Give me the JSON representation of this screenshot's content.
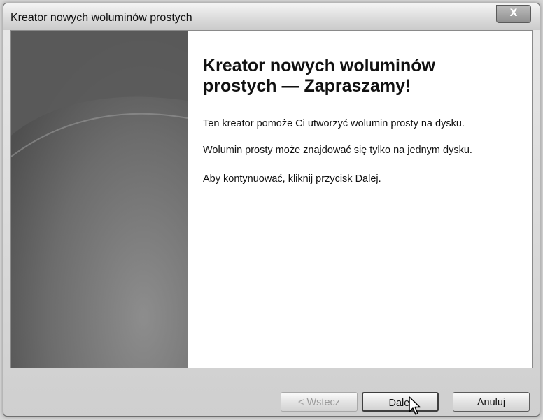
{
  "window": {
    "title": "Kreator nowych woluminów prostych",
    "close_label": "X"
  },
  "main": {
    "heading": "Kreator nowych woluminów prostych — Zapraszamy!",
    "paragraphs": [
      "Ten kreator pomoże Ci utworzyć wolumin prosty na dysku.",
      "Wolumin prosty może znajdować się tylko na jednym dysku.",
      "Aby kontynuować, kliknij przycisk Dalej."
    ]
  },
  "buttons": {
    "back": "< Wstecz",
    "next": "Dalej",
    "cancel": "Anuluj"
  },
  "icons": {
    "close": "close-icon",
    "cursor": "mouse-pointer-icon"
  }
}
